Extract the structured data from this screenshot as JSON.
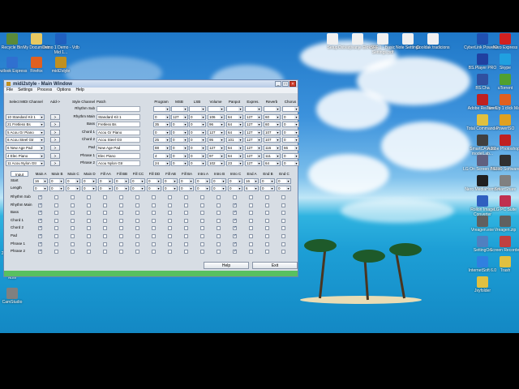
{
  "desktop_icons_left": [
    {
      "label": "Recycle Bin",
      "color": "#5a8a3a"
    },
    {
      "label": "My Documents",
      "color": "#e8c860"
    },
    {
      "label": "Demo 1 Demo - Vdb Mid 1...",
      "color": "#2060c0"
    },
    {
      "label": "Outlook Express",
      "color": "#3070d0"
    },
    {
      "label": "Firefox",
      "color": "#e06020"
    },
    {
      "label": "midi2style",
      "color": "#c09020"
    }
  ],
  "desktop_icons_top": [
    {
      "label": "Setup",
      "color": "#f0f0f0"
    },
    {
      "label": "Ostvarjivanje Ekrkova",
      "color": "#f0f0f0"
    },
    {
      "label": "SFF 1 - Basic Settings.pdf",
      "color": "#f0f0f0"
    },
    {
      "label": "Note Settings",
      "color": "#f0f0f0"
    },
    {
      "label": "Cooldak tradicions",
      "color": "#f0f0f0"
    }
  ],
  "desktop_icons_right": [
    {
      "label": "CyberLink PowerD...",
      "color": "#2050b0"
    },
    {
      "label": "Nero Express",
      "color": "#d02020"
    },
    {
      "label": "BS.Player PRO",
      "color": "#2040a0"
    },
    {
      "label": "Skype",
      "color": "#20a0e0"
    },
    {
      "label": "BS.Cha",
      "color": "#3050a0"
    },
    {
      "label": "uTorrent",
      "color": "#50a030"
    },
    {
      "label": "Adobe Reader 9",
      "color": "#c02020"
    },
    {
      "label": "TuneUp 1 click Mai...",
      "color": "#e06020"
    },
    {
      "label": "Total Commander",
      "color": "#e0c040"
    },
    {
      "label": "PowerISO",
      "color": "#e0a020"
    },
    {
      "label": "SmartCAM 20 modelLab...",
      "color": "#404040"
    },
    {
      "label": "Adobe Photoshop...",
      "color": "#c02020"
    },
    {
      "label": "LG On Screen Phone",
      "color": "#606080"
    },
    {
      "label": "NERO Software",
      "color": "#303030"
    },
    {
      "label": "Nero MediaHome 4",
      "color": "#202020"
    },
    {
      "label": "SmartShare",
      "color": "#808080"
    },
    {
      "label": "Rollon Image Converter",
      "color": "#3060c0"
    },
    {
      "label": "LG PC Suite",
      "color": "#c03050"
    },
    {
      "label": "Vreagen.exe",
      "color": "#606060"
    },
    {
      "label": "Vreagen.zip",
      "color": "#606060"
    },
    {
      "label": "SettingOn",
      "color": "#5080c0"
    },
    {
      "label": "Screen Recorder",
      "color": "#c04040"
    },
    {
      "label": "InternetSoft 6.0",
      "color": "#3080e0"
    },
    {
      "label": "Trash",
      "color": "#e0c040"
    },
    {
      "label": "Jxyfolder",
      "color": "#e0c040"
    }
  ],
  "desktop_icons_bottom_left": [
    {
      "label": "20032014...",
      "color": "#e0c040"
    },
    {
      "label": "New Folder",
      "color": "#e0c040"
    },
    {
      "label": "Note",
      "color": "#e0c040"
    },
    {
      "label": "CamStudio",
      "color": "#808080"
    }
  ],
  "window": {
    "title": "midi2style - Main Window",
    "controls": [
      "_",
      "□",
      "×"
    ],
    "menu": [
      "File",
      "Settings",
      "Process",
      "Options",
      "Help"
    ],
    "headers": {
      "select_midi": "Select MIDI Channel",
      "add": "Add->",
      "style_channel": "Style Channel",
      "patch": "Patch",
      "program": "Program",
      "msb": "MSB",
      "lsb": "LSB",
      "volume": "Volume",
      "panpot": "Panpot",
      "expression": "Expres.",
      "reverb": "Reverb",
      "chorus": "Chorus"
    },
    "rows": [
      {
        "midi": "",
        "channel": "Rhythm Sub",
        "patch": "",
        "program": "",
        "msb": "",
        "lsb": "",
        "volume": "",
        "panpot": "",
        "expr": "",
        "reverb": "",
        "chorus": ""
      },
      {
        "midi": "10 Standard Kit 1",
        "channel": "Rhythm Main",
        "patch": "Standard Kit 1",
        "program": "0",
        "msb": "127",
        "lsb": "0",
        "volume": "106",
        "panpot": "64",
        "expr": "127",
        "reverb": "60",
        "chorus": "0"
      },
      {
        "midi": "21 Fretless Bs",
        "channel": "Bass",
        "patch": "Fretless Bs",
        "program": "35",
        "msb": "0",
        "lsb": "0",
        "volume": "96",
        "panpot": "64",
        "expr": "127",
        "reverb": "60",
        "chorus": "0"
      },
      {
        "midi": "5 Acou Gr Piano",
        "channel": "Chord 1",
        "patch": "Acou Gr Piano",
        "program": "0",
        "msb": "0",
        "lsb": "0",
        "volume": "127",
        "panpot": "64",
        "expr": "127",
        "reverb": "107",
        "chorus": "0"
      },
      {
        "midi": "8 Acou Steel Gtr",
        "channel": "Chord 2",
        "patch": "Acou Steel Gtr",
        "program": "25",
        "msb": "0",
        "lsb": "0",
        "volume": "95",
        "panpot": "101",
        "expr": "127",
        "reverb": "107",
        "chorus": "0"
      },
      {
        "midi": "6 New Age Pad",
        "channel": "Pad",
        "patch": "New Age Pad",
        "program": "88",
        "msb": "0",
        "lsb": "0",
        "volume": "127",
        "panpot": "64",
        "expr": "127",
        "reverb": "116",
        "chorus": "66"
      },
      {
        "midi": "4 Elec Piano",
        "channel": "Phrase 1",
        "patch": "Elec Piano",
        "program": "4",
        "msb": "0",
        "lsb": "0",
        "volume": "97",
        "panpot": "64",
        "expr": "127",
        "reverb": "111",
        "chorus": "0"
      },
      {
        "midi": "11 Acou Nylon Gtr",
        "channel": "Phrase 2",
        "patch": "Acou Nylon Gtr",
        "program": "24",
        "msb": "0",
        "lsb": "0",
        "volume": "102",
        "panpot": "23",
        "expr": "127",
        "reverb": "64",
        "chorus": "0"
      }
    ],
    "add_button": ">",
    "sections": [
      "Input",
      "Main A",
      "Main B",
      "Main C",
      "Main D",
      "Fill AA",
      "Fill BB",
      "Fill CC",
      "Fill DD",
      "Fill AB",
      "Fill BA",
      "Intro A",
      "Intro B",
      "Intro C",
      "End A",
      "End B",
      "End C"
    ],
    "start_label": "Start",
    "length_label": "Length",
    "start_values": [
      "16",
      "0",
      "0",
      "0",
      "0",
      "0",
      "0",
      "0",
      "0",
      "0",
      "0",
      "0",
      "0",
      "16",
      "0",
      "0"
    ],
    "length_values": [
      "0",
      "0",
      "0",
      "0",
      "0",
      "0",
      "0",
      "0",
      "0",
      "0",
      "0",
      "0",
      "0",
      "6",
      "0",
      "0"
    ],
    "check_rows": [
      "Rhythm Sub",
      "Rhythm Main",
      "Bass",
      "Chord 1",
      "Chord 2",
      "Pad",
      "Phrase 1",
      "Phrase 2"
    ],
    "help_button": "Help",
    "exit_button": "Exit"
  }
}
